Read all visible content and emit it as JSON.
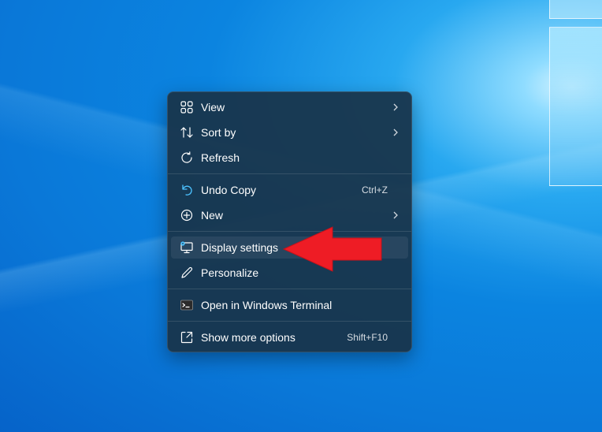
{
  "menu": {
    "items": [
      {
        "label": "View",
        "icon": "grid-view-icon"
      },
      {
        "label": "Sort by",
        "icon": "sort-icon"
      },
      {
        "label": "Refresh",
        "icon": "refresh-icon"
      },
      {
        "label": "Undo Copy",
        "icon": "undo-icon",
        "shortcut": "Ctrl+Z"
      },
      {
        "label": "New",
        "icon": "add-circle-icon"
      },
      {
        "label": "Display settings",
        "icon": "display-settings-icon"
      },
      {
        "label": "Personalize",
        "icon": "pen-icon"
      },
      {
        "label": "Open in Windows Terminal",
        "icon": "terminal-icon"
      },
      {
        "label": "Show more options",
        "icon": "expand-icon",
        "shortcut": "Shift+F10"
      }
    ]
  },
  "colors": {
    "menu_bg": "#18344a",
    "accent_icon": "#4cc2ff",
    "arrow": "#ee1c25"
  }
}
